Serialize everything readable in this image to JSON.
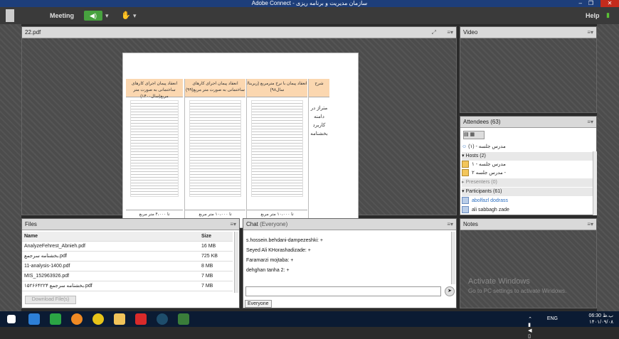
{
  "window": {
    "title": "Adobe Connect - سازمان مدیریت و برنامه ریزی",
    "minimize": "–",
    "restore": "❐",
    "close": "✕"
  },
  "menu": {
    "meeting": "Meeting",
    "help": "Help",
    "speaker_icon": "speaker-icon"
  },
  "share_pod": {
    "title": "22.pdf",
    "slide": {
      "columns": [
        {
          "header": "شرح",
          "footer": ""
        },
        {
          "header": "انعقاد پیمان با نرخ مترمربع (زیربنا/سال۹۸)",
          "footer": "تا ۱۰،۰۰۰ متر مربع"
        },
        {
          "header": "انعقاد پیمان اجرای کارهای ساختمانی به صورت متر مربع(۹۹)",
          "footer": "تا ۱۰،۰۰۰ متر مربع"
        },
        {
          "header": "انعقاد پیمان اجرای کارهای ساختمانی به صورت متر مربع(سال۱۴۰۰)",
          "footer": "تا ۴،۰۰۰ متر مربع"
        }
      ],
      "side_text": "متراژ در دامنه کاربرد بخشنامه"
    }
  },
  "video_pod": {
    "title": "Video"
  },
  "attendees_pod": {
    "title": "Attendees",
    "count": "(63)",
    "me": "مدرس جلسه - (۱)",
    "hosts_label": "Hosts (2)",
    "hosts": [
      "مدرس جلسه - ۱",
      "مدرس جلسه ۲ -"
    ],
    "presenters_label": "Presenters (0)",
    "participants_label": "Participants (61)",
    "participants": [
      "abolfazl dodrass",
      "ali sabbagh zade"
    ]
  },
  "files_pod": {
    "title": "Files",
    "headers": {
      "name": "Name",
      "size": "Size"
    },
    "rows": [
      {
        "name": "AnalyzeFehrest_Abnieh.pdf",
        "size": "16 MB"
      },
      {
        "name": "بخشنامه سرجمع.pdf",
        "size": "725 KB"
      },
      {
        "name": "11-analysis-1400.pdf",
        "size": "8 MB"
      },
      {
        "name": "MIS_152963926.pdf",
        "size": "7 MB"
      },
      {
        "name": "بخشنامه سرجمع ۱۵۲۶۶۴۲۲۴.pdf",
        "size": "7 MB"
      }
    ],
    "download_label": "Download File(s)"
  },
  "chat_pod": {
    "title": "Chat",
    "scope": "(Everyone)",
    "messages": [
      "s.hossein.behdani-dampezeshki: +",
      "Seyed Ali KHorashadizade: +",
      "Faramarzi mojtaba: +",
      "dehghan tanha 2: +"
    ],
    "recipient": "Everyone"
  },
  "notes_pod": {
    "title": "Notes"
  },
  "watermark": {
    "line1": "Activate Windows",
    "line2": "Go to PC settings to activate Windows."
  },
  "taskbar": {
    "time": "06:30 ب.ظ",
    "date": "۱۴۰۱/۰۹/۰۸",
    "lang": "ENG"
  }
}
